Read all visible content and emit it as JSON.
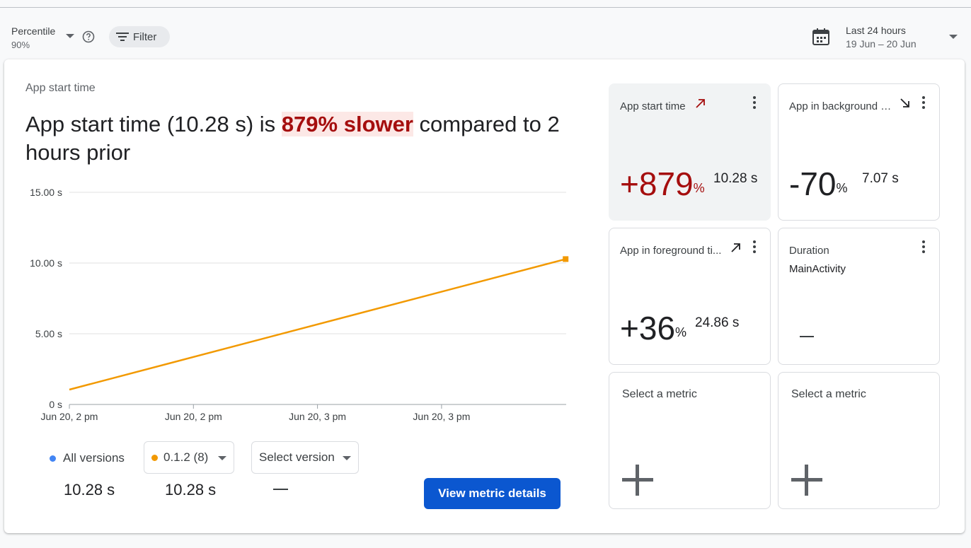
{
  "toolbar": {
    "percentile_label": "Percentile",
    "percentile_value": "90%",
    "filter_label": "Filter",
    "date_range_label": "Last 24 hours",
    "date_range_sub": "19 Jun – 20 Jun"
  },
  "card": {
    "subtitle": "App start time",
    "headline_before": "App start time (10.28 s) is ",
    "headline_highlight": "879% slower",
    "headline_after": " compared to 2 hours prior"
  },
  "chart_data": {
    "type": "line",
    "x": [
      "Jun 20, 2 pm",
      "Jun 20, 2 pm",
      "Jun 20, 3 pm",
      "Jun 20, 3 pm"
    ],
    "y_ticks": [
      "15.00 s",
      "10.00 s",
      "5.00 s",
      "0 s"
    ],
    "ylim": [
      0,
      15
    ],
    "series": [
      {
        "version": "0.1.2 (8)",
        "color": "#f29900",
        "points": [
          [
            0,
            1.05
          ],
          [
            4,
            10.28
          ]
        ]
      }
    ],
    "grid": true
  },
  "legend": {
    "all_versions_label": "All versions",
    "all_versions_color": "#4285f4",
    "all_versions_value": "10.28 s",
    "version_label": "0.1.2 (8)",
    "version_color": "#f29900",
    "version_value": "10.28 s",
    "select_version_label": "Select version",
    "select_version_value": "—"
  },
  "view_details_label": "View metric details",
  "tiles": [
    {
      "title": "App start time",
      "trend": "up",
      "change": "+879",
      "unit": "%",
      "value": "10.28 s",
      "color": "#a50e0e"
    },
    {
      "title": "App in background t...",
      "trend": "down",
      "change": "-70",
      "unit": "%",
      "value": "7.07 s",
      "color": "#202124"
    },
    {
      "title": "App in foreground ti...",
      "trend": "up",
      "change": "+36",
      "unit": "%",
      "value": "24.86 s",
      "color": "#202124"
    },
    {
      "title": "Duration",
      "subtitle": "MainActivity",
      "value": "—"
    },
    {
      "title": "Select a metric"
    },
    {
      "title": "Select a metric"
    }
  ]
}
